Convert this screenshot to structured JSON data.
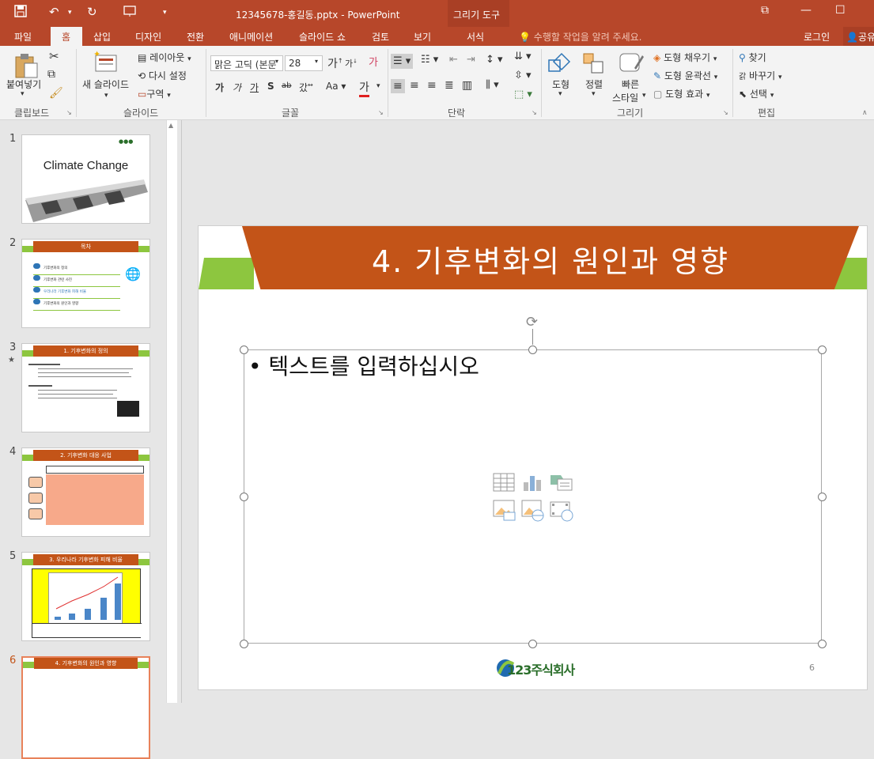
{
  "titlebar": {
    "doc_title": "12345678-홍길동.pptx - PowerPoint",
    "context_group": "그리기 도구"
  },
  "tabs": {
    "file": "파일",
    "home": "홈",
    "insert": "삽입",
    "design": "디자인",
    "transitions": "전환",
    "animations": "애니메이션",
    "slideshow": "슬라이드 쇼",
    "review": "검토",
    "view": "보기",
    "format": "서식",
    "tellme": "수행할 작업을 알려 주세요.",
    "signin": "로그인",
    "share": "공유"
  },
  "ribbon": {
    "clipboard": {
      "paste": "붙여넣기",
      "label": "클립보드"
    },
    "slides": {
      "new_slide": "새 슬라이드",
      "layout": "레이아웃",
      "reset": "다시 설정",
      "section": "구역",
      "label": "슬라이드"
    },
    "font": {
      "face": "맑은 고딕 (본문",
      "size": "28",
      "label": "글꼴"
    },
    "paragraph": {
      "label": "단락"
    },
    "drawing": {
      "shapes": "도형",
      "arrange": "정렬",
      "quick_styles_1": "빠른",
      "quick_styles_2": "스타일",
      "fill": "도형 채우기",
      "outline": "도형 윤곽선",
      "effects": "도형 효과",
      "label": "그리기"
    },
    "editing": {
      "find": "찾기",
      "replace": "바꾸기",
      "select": "선택",
      "label": "편집"
    }
  },
  "thumbnails": [
    {
      "num": "1",
      "title": "Climate Change"
    },
    {
      "num": "2",
      "title": "목차",
      "items": [
        "기후변화의 정의",
        "기후변화 관련 사진",
        "우리나라 기후변화 피해 비율",
        "기후변화의 원인과 영향"
      ]
    },
    {
      "num": "3",
      "title": "1. 기후변화의 정의"
    },
    {
      "num": "4",
      "title": "2. 기후변화 대응 사업"
    },
    {
      "num": "5",
      "title": "3. 우리나라 기후변화 피해 비율"
    },
    {
      "num": "6",
      "title": "4. 기후변화의 원인과 영향"
    }
  ],
  "slide": {
    "title": "4. 기후변화의 원인과 영향",
    "placeholder_text": "텍스트를 입력하십시오",
    "page_number": "6",
    "logo_text": "123주식회사"
  },
  "colors": {
    "accent": "#b7472a",
    "slide_orange": "#c35418",
    "slide_green": "#8dc63f"
  }
}
